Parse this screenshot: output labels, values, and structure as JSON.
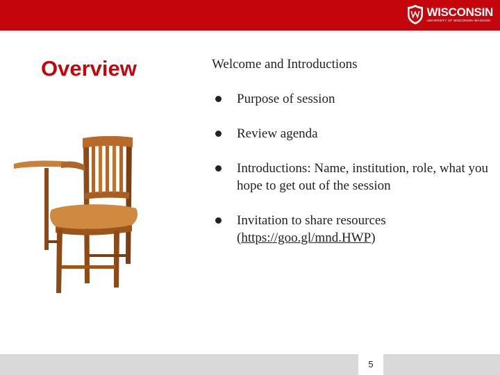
{
  "header": {
    "logo_wordmark": "WISCONSIN",
    "logo_tagline": "UNIVERSITY OF WISCONSIN–MADISON",
    "brand_color": "#c5050c"
  },
  "slide": {
    "title": "Overview",
    "heading": "Welcome and Introductions",
    "bullets": [
      {
        "text": "Purpose of session"
      },
      {
        "text": "Review agenda"
      },
      {
        "text": "Introductions:  Name, institution, role, what you hope to get out of the session"
      },
      {
        "text_before": "Invitation to share resources (",
        "link": "https://goo.gl/mnd.HWP",
        "text_after": ")"
      }
    ],
    "image": "wooden-tablet-arm-chair",
    "page_number": "5"
  }
}
